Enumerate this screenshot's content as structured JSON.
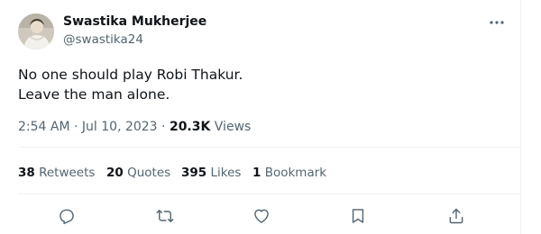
{
  "author": {
    "name": "Swastika Mukherjee",
    "handle": "@swastika24"
  },
  "tweet": {
    "line1": "No one should play Robi Thakur.",
    "line2": "Leave the man alone."
  },
  "meta": {
    "time": "2:54 AM",
    "separator1": " · ",
    "date": "Jul 10, 2023",
    "separator2": " · ",
    "views_count": "20.3K",
    "views_label": " Views"
  },
  "stats": {
    "retweets_count": "38",
    "retweets_label": " Retweets",
    "quotes_count": "20",
    "quotes_label": " Quotes",
    "likes_count": "395",
    "likes_label": " Likes",
    "bookmarks_count": "1",
    "bookmarks_label": " Bookmark"
  },
  "icons": {
    "more": "more-dots-icon",
    "reply": "reply-icon",
    "retweet": "retweet-icon",
    "like": "like-icon",
    "bookmark": "bookmark-icon",
    "share": "share-icon"
  },
  "colors": {
    "text_primary": "#0f1419",
    "text_secondary": "#536471",
    "divider": "#eff3f4"
  }
}
